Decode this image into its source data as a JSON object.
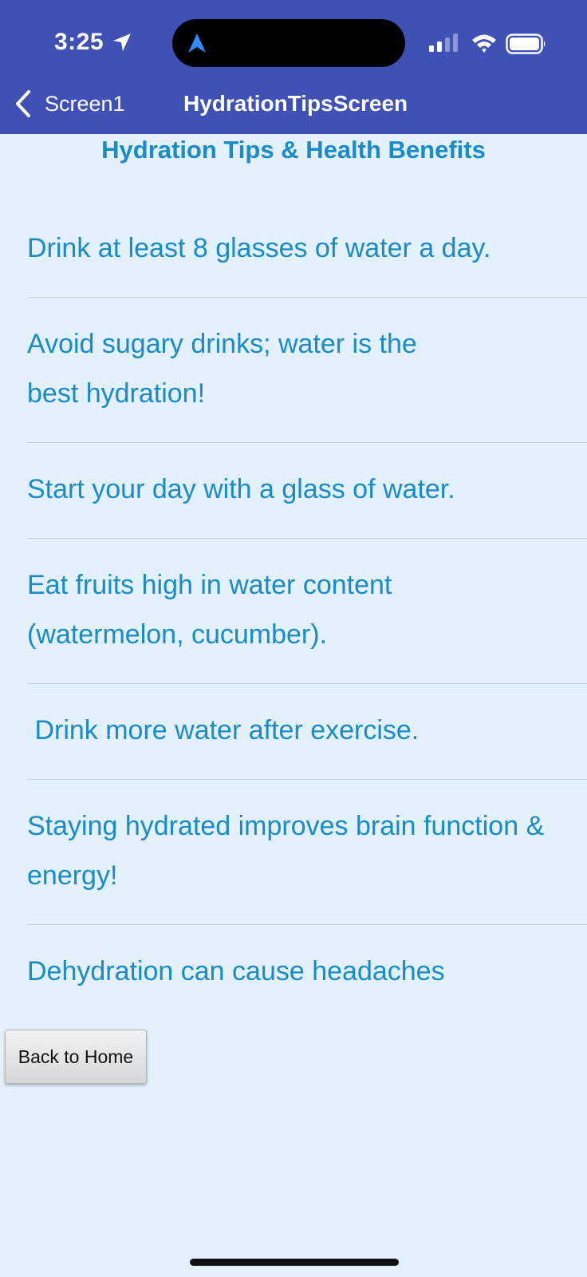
{
  "status_bar": {
    "time": "3:25",
    "icons": [
      "location-arrow-icon",
      "navigation-arrow-icon",
      "cellular-signal-icon",
      "wifi-icon",
      "battery-icon"
    ]
  },
  "nav": {
    "back_label": "Screen1",
    "title": "HydrationTipsScreen"
  },
  "page": {
    "title": "Hydration Tips & Health Benefits"
  },
  "tips": [
    "Drink at least 8 glasses of water a day.",
    "Avoid sugary drinks; water is the best hydration!",
    "Start your day with a glass of water.",
    "Eat fruits high in water content (watermelon, cucumber).",
    " Drink more water after exercise.",
    "Staying hydrated improves brain function & energy!",
    "Dehydration can cause headaches"
  ],
  "actions": {
    "back_home_label": "Back to Home"
  },
  "colors": {
    "header_bg": "#3f51b5",
    "background": "#e2f1fb",
    "accent_text": "#1a8bc9"
  }
}
